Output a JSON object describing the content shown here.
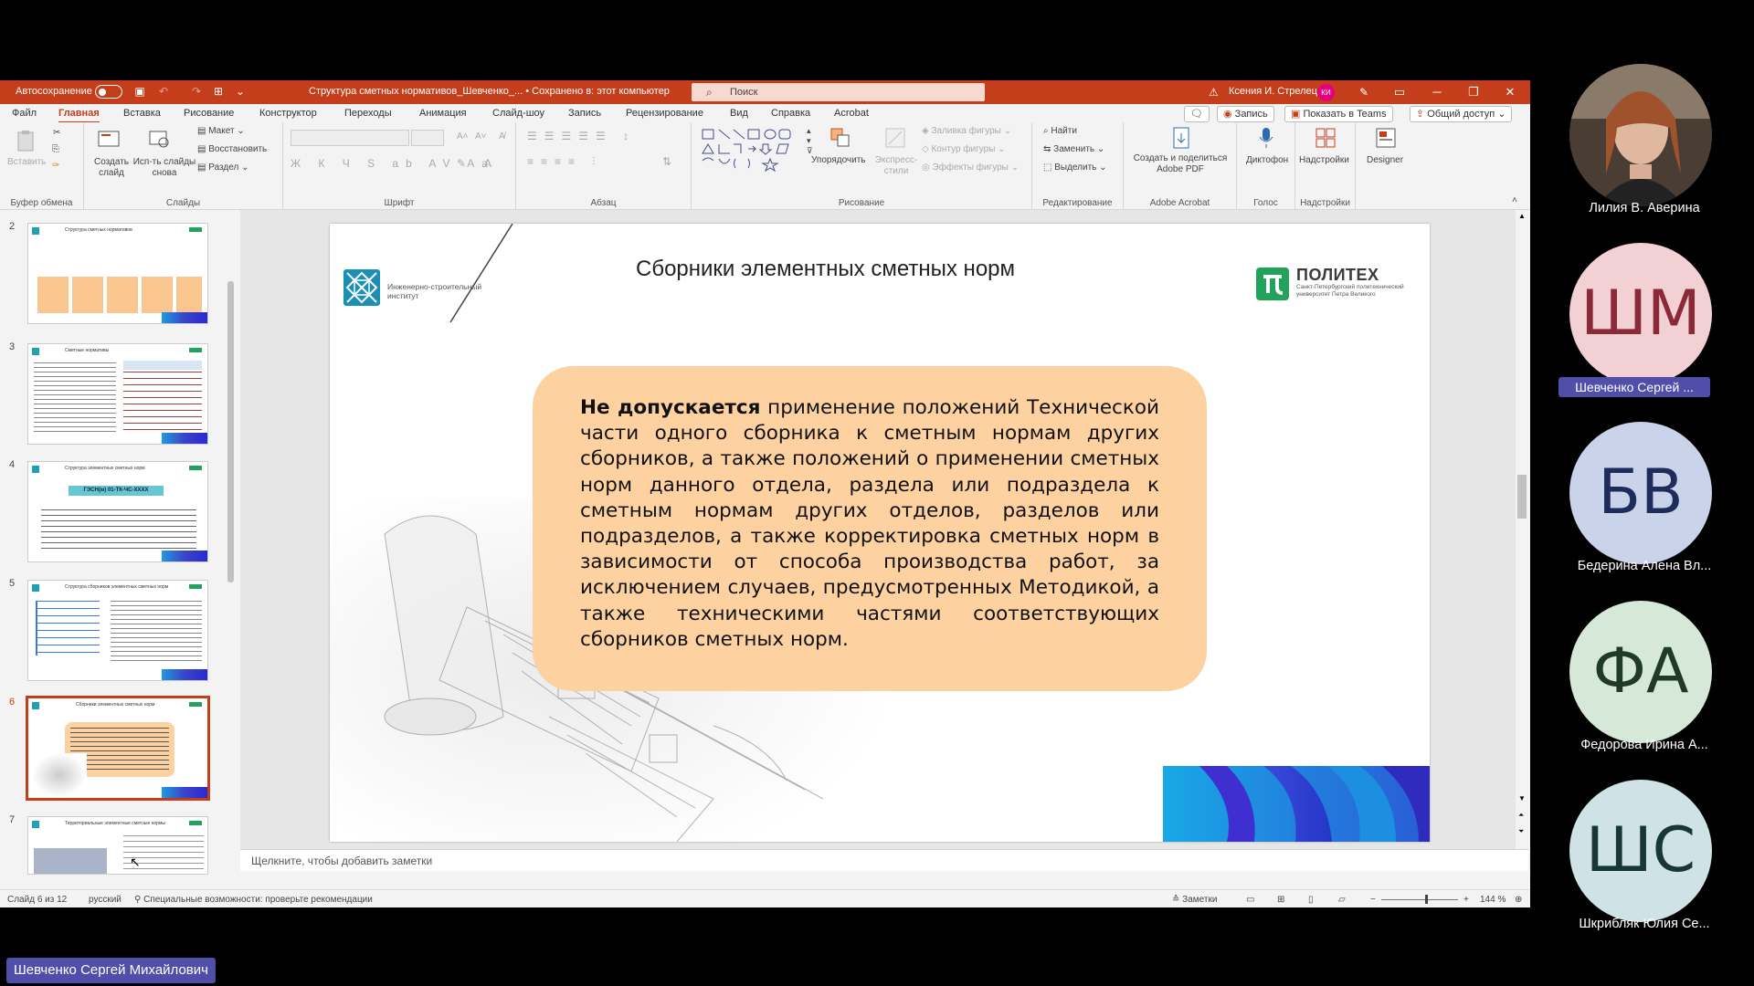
{
  "window": {
    "autosave_label": "Автосохранение",
    "doc_title": "Структура сметных нормативов_Шевченко_... • Сохранено в: этот компьютер",
    "search_placeholder": "Поиск",
    "user_name": "Ксения И. Стрелец",
    "user_initials": "КИ",
    "accent_color": "#c43e1c"
  },
  "menu": {
    "items": [
      "Файл",
      "Главная",
      "Вставка",
      "Рисование",
      "Конструктор",
      "Переходы",
      "Анимация",
      "Слайд-шоу",
      "Запись",
      "Рецензирование",
      "Вид",
      "Справка",
      "Acrobat"
    ],
    "active": "Главная",
    "record_button": "Запись",
    "teams_button": "Показать в Teams",
    "share_button": "Общий доступ"
  },
  "ribbon": {
    "clipboard": {
      "paste": "Вставить",
      "label": "Буфер обмена"
    },
    "slides": {
      "new_slide": "Создать слайд",
      "reuse": "Исп-ть слайды снова",
      "layout": "Макет",
      "reset": "Восстановить",
      "section": "Раздел",
      "label": "Слайды"
    },
    "font": {
      "label": "Шрифт"
    },
    "paragraph": {
      "label": "Абзац"
    },
    "drawing": {
      "arrange": "Упорядочить",
      "quick_styles": "Экспресс-стили",
      "fill": "Заливка фигуры",
      "outline": "Контур фигуры",
      "effects": "Эффекты фигуры",
      "label": "Рисование"
    },
    "editing": {
      "find": "Найти",
      "replace": "Заменить",
      "select": "Выделить",
      "label": "Редактирование"
    },
    "acrobat": {
      "create": "Создать и поделиться Adobe PDF",
      "label": "Adobe Acrobat"
    },
    "voice": {
      "dictate": "Диктофон",
      "label": "Голос"
    },
    "addins": {
      "addins": "Надстройки",
      "label": "Надстройки"
    },
    "designer": {
      "label": "Designer"
    }
  },
  "thumbnails": [
    {
      "num": "2",
      "title": "Структура сметных нормативов"
    },
    {
      "num": "3",
      "title": "Сметные нормативы"
    },
    {
      "num": "4",
      "title": "Структура элементных сметных норм"
    },
    {
      "num": "5",
      "title": "Структура сборников элементных сметных норм"
    },
    {
      "num": "6",
      "title": "Сборники элементных сметных норм"
    },
    {
      "num": "7",
      "title": "Территориальные элементные сметные нормы"
    }
  ],
  "thumb_mini": {
    "slide4_code": "ГЭСН(м) 01-ТК-ЧС-ХХХХ"
  },
  "selected_thumbnail": "6",
  "slide": {
    "title": "Сборники элементных сметных норм",
    "brand_left": "Инженерно-строительный институт",
    "brand_right_name": "ПОЛИТЕХ",
    "brand_right_sub": "Санкт-Петербургский политехнический университет Петра Великого",
    "callout_bold": "Не допускается",
    "callout_text": " применение положений Технической части одного сборника к сметным нормам других сборников, а также положений о применении сметных норм данного отдела, раздела или подраздела к сметным нормам других отделов, разделов или подразделов, а также корректировка сметных норм в зависимости от способа производства работ, за исключением случаев, предусмотренных Методикой, а также техническими частями соответствующих сборников сметных норм."
  },
  "notes_placeholder": "Щелкните, чтобы добавить заметки",
  "status": {
    "slide_counter": "Слайд 6 из 12",
    "language": "русский",
    "accessibility": "Специальные возможности: проверьте рекомендации",
    "notes": "Заметки",
    "zoom": "144 %"
  },
  "participants": [
    {
      "name": "Лилия В. Аверина",
      "initials": "",
      "bg": "#5a4a40",
      "fg": "#fff",
      "photo": true
    },
    {
      "name": "Шевченко Сергей ...",
      "initials": "ШМ",
      "bg": "#f2d0d4",
      "fg": "#8a2a38",
      "highlighted": true
    },
    {
      "name": "Бедерина Алена Вл...",
      "initials": "БВ",
      "bg": "#c9d4ea",
      "fg": "#1d2c5a"
    },
    {
      "name": "Федорова Ирина А...",
      "initials": "ФА",
      "bg": "#d6e8d8",
      "fg": "#1f3a26"
    },
    {
      "name": "Шкрибляк Юлия Се...",
      "initials": "ШС",
      "bg": "#cfe3e6",
      "fg": "#183638"
    }
  ],
  "active_speaker": "Шевченко Сергей Михайлович"
}
